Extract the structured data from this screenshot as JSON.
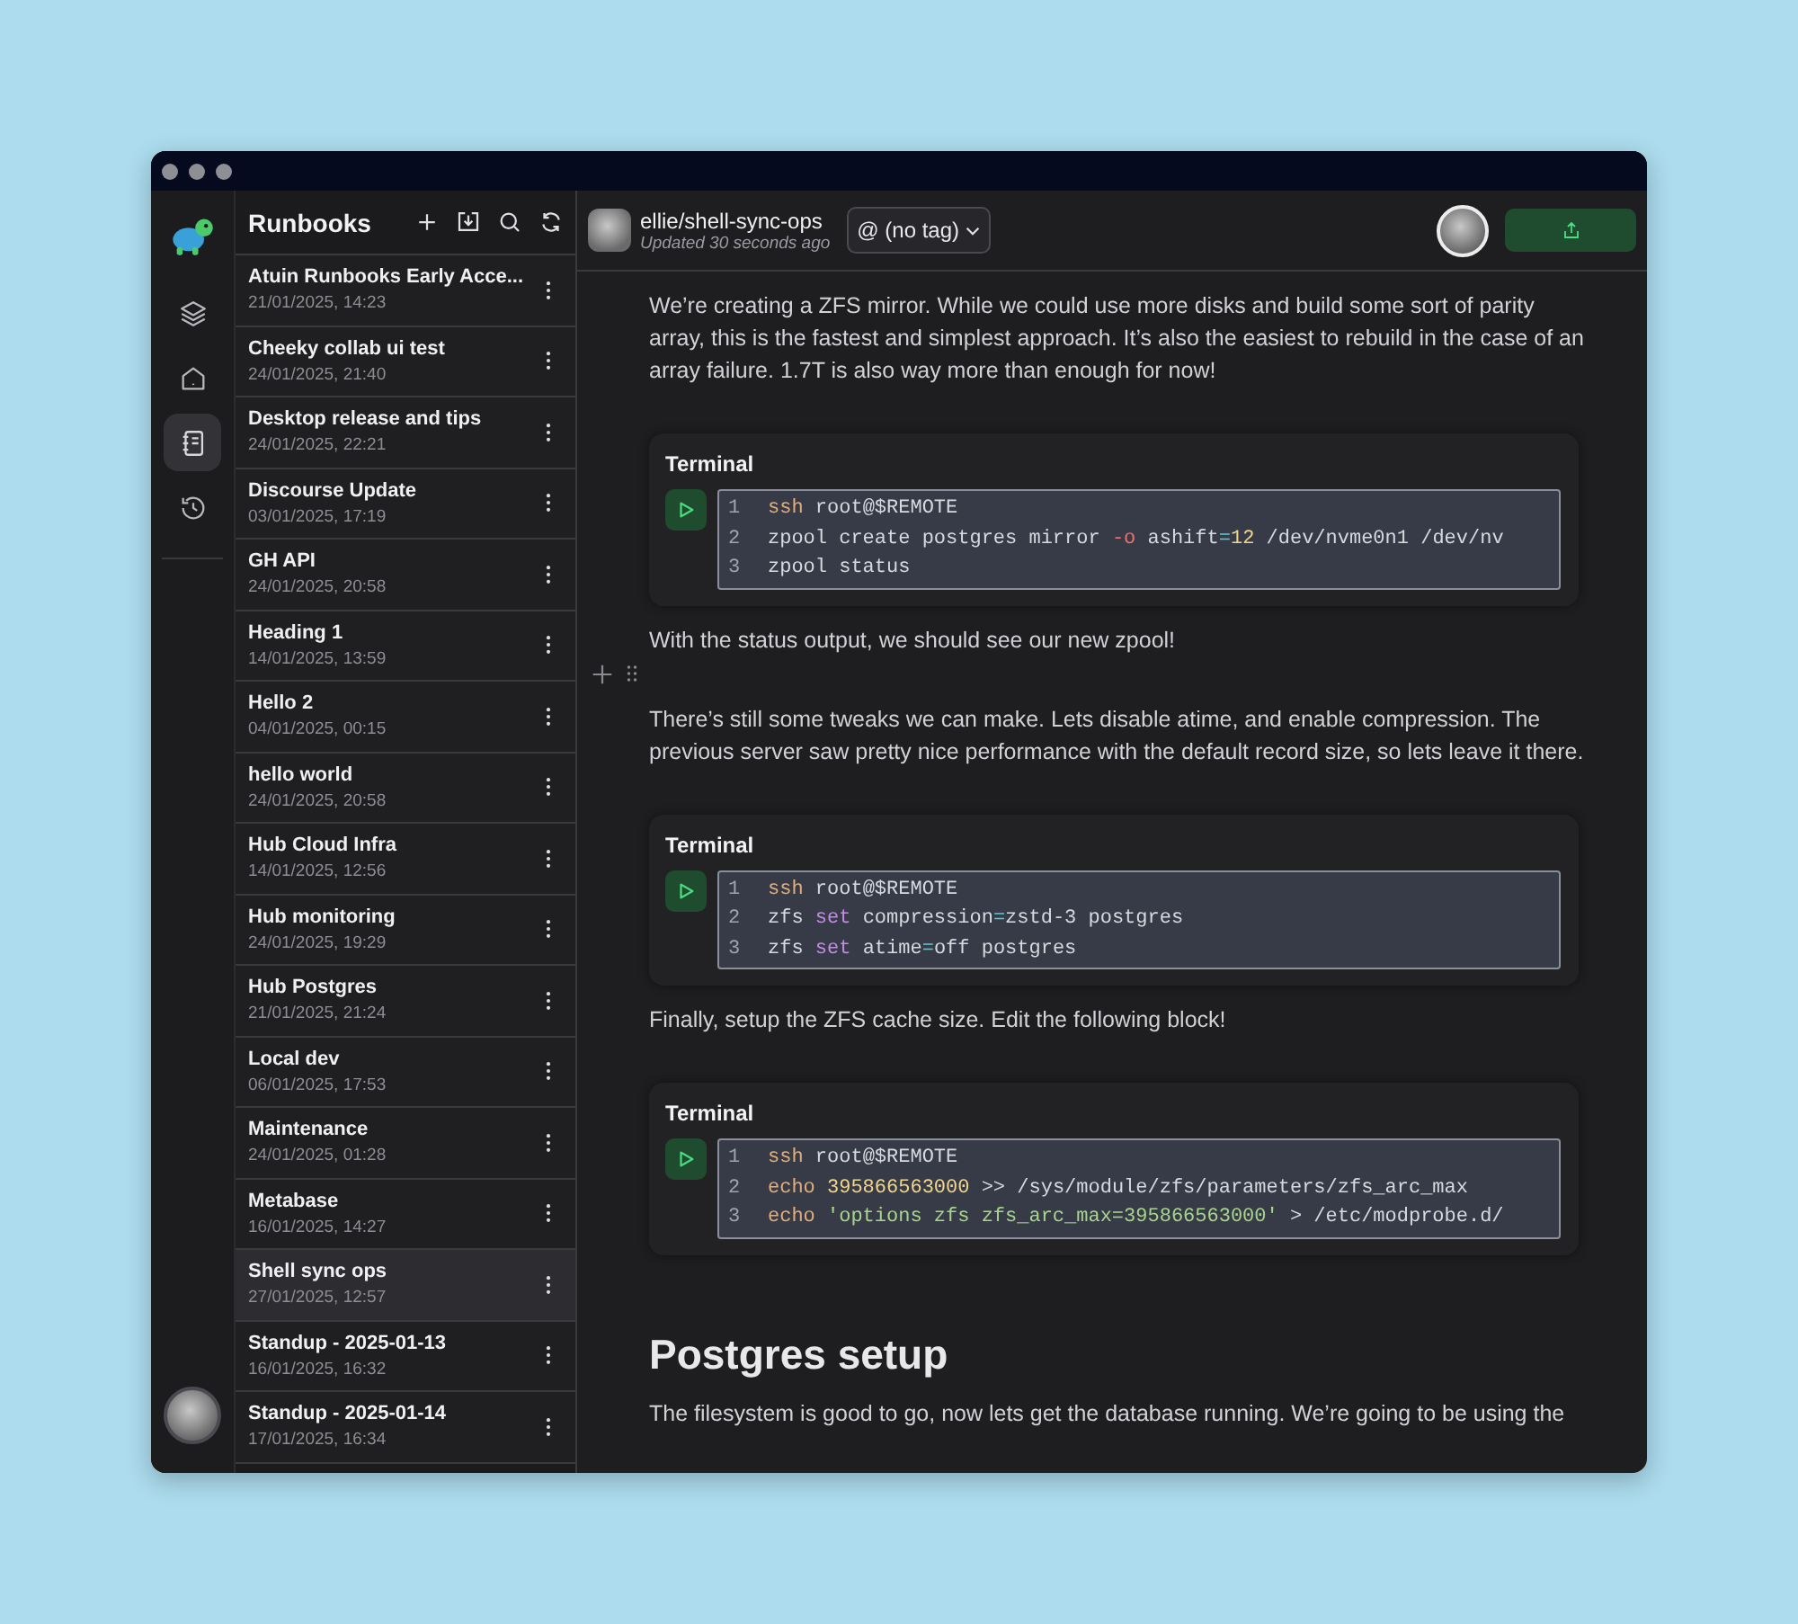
{
  "rail": {
    "items": [
      {
        "kind": "layers",
        "selected": false
      },
      {
        "kind": "home",
        "selected": false
      },
      {
        "kind": "notebook",
        "selected": true
      },
      {
        "kind": "history",
        "selected": false
      }
    ]
  },
  "runbooks": {
    "title": "Runbooks",
    "items": [
      {
        "name": "Atuin Runbooks Early Acce...",
        "date": "21/01/2025, 14:23",
        "selected": false
      },
      {
        "name": "Cheeky collab ui test",
        "date": "24/01/2025, 21:40",
        "selected": false
      },
      {
        "name": "Desktop release and tips",
        "date": "24/01/2025, 22:21",
        "selected": false
      },
      {
        "name": "Discourse Update",
        "date": "03/01/2025, 17:19",
        "selected": false
      },
      {
        "name": "GH API",
        "date": "24/01/2025, 20:58",
        "selected": false
      },
      {
        "name": "Heading 1",
        "date": "14/01/2025, 13:59",
        "selected": false
      },
      {
        "name": "Hello 2",
        "date": "04/01/2025, 00:15",
        "selected": false
      },
      {
        "name": "hello world",
        "date": "24/01/2025, 20:58",
        "selected": false
      },
      {
        "name": "Hub Cloud Infra",
        "date": "14/01/2025, 12:56",
        "selected": false
      },
      {
        "name": "Hub monitoring",
        "date": "24/01/2025, 19:29",
        "selected": false
      },
      {
        "name": "Hub Postgres",
        "date": "21/01/2025, 21:24",
        "selected": false
      },
      {
        "name": "Local dev",
        "date": "06/01/2025, 17:53",
        "selected": false
      },
      {
        "name": "Maintenance",
        "date": "24/01/2025, 01:28",
        "selected": false
      },
      {
        "name": "Metabase",
        "date": "16/01/2025, 14:27",
        "selected": false
      },
      {
        "name": "Shell sync ops",
        "date": "27/01/2025, 12:57",
        "selected": true
      },
      {
        "name": "Standup - 2025-01-13",
        "date": "16/01/2025, 16:32",
        "selected": false
      },
      {
        "name": "Standup - 2025-01-14",
        "date": "17/01/2025, 16:34",
        "selected": false
      }
    ]
  },
  "header": {
    "path": "ellie/shell-sync-ops",
    "updated": "Updated 30 seconds ago",
    "tag": "@ (no tag)"
  },
  "content": [
    {
      "kind": "paragraph",
      "text": "We’re creating a ZFS mirror. While we could use more disks and build some sort of parity array, this is the fastest and simplest approach. It’s also the easiest to rebuild in the case of an array failure. 1.7T is also way more than enough for now!"
    },
    {
      "kind": "terminal",
      "title": "Terminal",
      "lines": [
        {
          "number": "1",
          "tokens": [
            {
              "text": "ssh",
              "kind": "cmd"
            },
            {
              "text": " root@$REMOTE",
              "kind": "plain"
            }
          ]
        },
        {
          "number": "2",
          "tokens": [
            {
              "text": "zpool create postgres mirror ",
              "kind": "plain"
            },
            {
              "text": "-o",
              "kind": "flag"
            },
            {
              "text": " ashift",
              "kind": "plain"
            },
            {
              "text": "=",
              "kind": "op"
            },
            {
              "text": "12",
              "kind": "num"
            },
            {
              "text": " /dev/nvme0n1 /dev/nv",
              "kind": "plain"
            }
          ]
        },
        {
          "number": "3",
          "tokens": [
            {
              "text": "zpool status",
              "kind": "plain"
            }
          ]
        }
      ]
    },
    {
      "kind": "paragraph",
      "text": "With the status output, we should see our new zpool!"
    },
    {
      "kind": "empty",
      "hovered": true
    },
    {
      "kind": "paragraph",
      "text": "There’s still some tweaks we can make. Lets disable atime, and enable compression. The previous server saw pretty nice performance with the default record size, so lets leave it there."
    },
    {
      "kind": "terminal",
      "title": "Terminal",
      "lines": [
        {
          "number": "1",
          "tokens": [
            {
              "text": "ssh",
              "kind": "cmd"
            },
            {
              "text": " root@$REMOTE",
              "kind": "plain"
            }
          ]
        },
        {
          "number": "2",
          "tokens": [
            {
              "text": "zfs ",
              "kind": "plain"
            },
            {
              "text": "set",
              "kind": "keyword"
            },
            {
              "text": " compression",
              "kind": "plain"
            },
            {
              "text": "=",
              "kind": "op"
            },
            {
              "text": "zstd-3 postgres",
              "kind": "plain"
            }
          ]
        },
        {
          "number": "3",
          "tokens": [
            {
              "text": "zfs ",
              "kind": "plain"
            },
            {
              "text": "set",
              "kind": "keyword"
            },
            {
              "text": " atime",
              "kind": "plain"
            },
            {
              "text": "=",
              "kind": "op"
            },
            {
              "text": "off postgres",
              "kind": "plain"
            }
          ]
        }
      ]
    },
    {
      "kind": "paragraph",
      "text": "Finally, setup the ZFS cache size. Edit the following block!"
    },
    {
      "kind": "terminal",
      "title": "Terminal",
      "lines": [
        {
          "number": "1",
          "tokens": [
            {
              "text": "ssh",
              "kind": "cmd"
            },
            {
              "text": " root@$REMOTE",
              "kind": "plain"
            }
          ]
        },
        {
          "number": "2",
          "tokens": [
            {
              "text": "echo",
              "kind": "cmd"
            },
            {
              "text": " 395866563000",
              "kind": "num"
            },
            {
              "text": " >> /sys/module/zfs/parameters/zfs_arc_max",
              "kind": "plain"
            }
          ]
        },
        {
          "number": "3",
          "tokens": [
            {
              "text": "echo",
              "kind": "cmd"
            },
            {
              "text": " 'options zfs zfs_arc_max=395866563000'",
              "kind": "str"
            },
            {
              "text": " > /etc/modprobe.d/",
              "kind": "plain"
            }
          ]
        }
      ]
    },
    {
      "kind": "heading",
      "text": "Postgres setup"
    },
    {
      "kind": "paragraph",
      "text": "The filesystem is good to go, now lets get the database running. We’re going to be using the"
    }
  ]
}
